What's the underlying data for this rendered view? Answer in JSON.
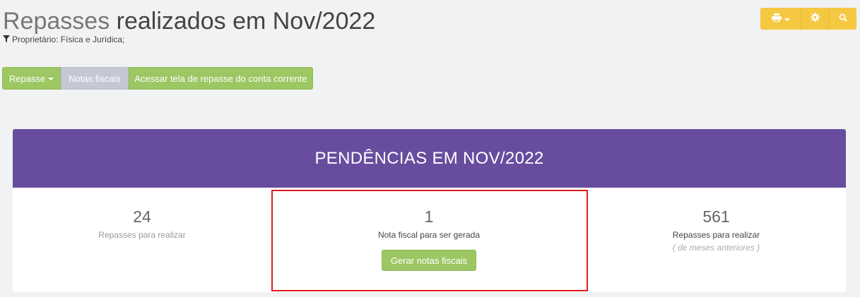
{
  "header": {
    "title_light": "Repasses",
    "title_rest": " realizados em Nov/2022",
    "filter_text": "Proprietário: Física e Jurídica;"
  },
  "toolbar": {
    "repasse_label": "Repasse",
    "notas_label": "Notas fiscais",
    "acessar_label": "Acessar tela de repasse do conta corrente"
  },
  "top_tools": {
    "color": "#f5c842",
    "icons": [
      "print-icon",
      "gear-icon",
      "search-icon"
    ]
  },
  "panel": {
    "heading": "PENDÊNCIAS EM NOV/2022",
    "heading_bg": "#684d9e",
    "col1": {
      "count": "24",
      "label": "Repasses para realizar"
    },
    "col2": {
      "count": "1",
      "label": "Nota fiscal para ser gerada",
      "button": "Gerar notas fiscais"
    },
    "col3": {
      "count": "561",
      "label": "Repasses para realizar",
      "sublabel": "( de meses anteriores )"
    }
  },
  "colors": {
    "accent_green": "#9cc763",
    "highlight_red": "#e31b1b"
  }
}
